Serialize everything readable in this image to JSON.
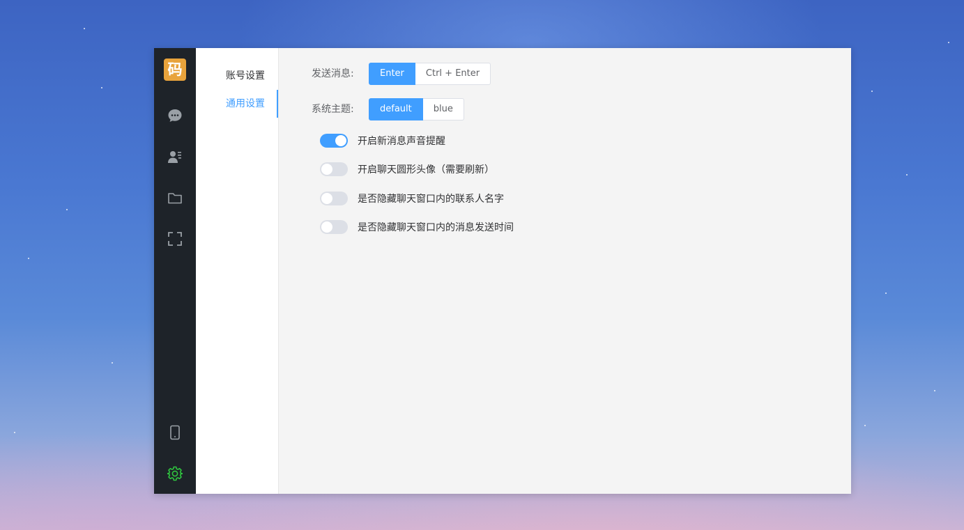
{
  "rail": {
    "logo_text": "码",
    "colors": {
      "background": "#1e2329",
      "logo": "#e8a33c",
      "icon": "#9aa0a6",
      "active_icon": "#2fc43f"
    },
    "icons": [
      "chat-icon",
      "contacts-icon",
      "folder-icon",
      "fullscreen-icon",
      "phone-icon",
      "settings-gear-icon"
    ]
  },
  "menu": {
    "items": [
      {
        "label": "账号设置",
        "active": false
      },
      {
        "label": "通用设置",
        "active": true
      }
    ]
  },
  "content": {
    "send_message": {
      "label": "发送消息:",
      "options": [
        "Enter",
        "Ctrl + Enter"
      ],
      "selected": "Enter"
    },
    "system_theme": {
      "label": "系统主题:",
      "options": [
        "default",
        "blue"
      ],
      "selected": "default"
    },
    "toggles": [
      {
        "label": "开启新消息声音提醒",
        "on": true
      },
      {
        "label": "开启聊天圆形头像（需要刷新）",
        "on": false
      },
      {
        "label": "是否隐藏聊天窗口内的联系人名字",
        "on": false
      },
      {
        "label": "是否隐藏聊天窗口内的消息发送时间",
        "on": false
      }
    ]
  },
  "colors": {
    "accent": "#409eff",
    "switch_off": "#dcdfe6"
  }
}
